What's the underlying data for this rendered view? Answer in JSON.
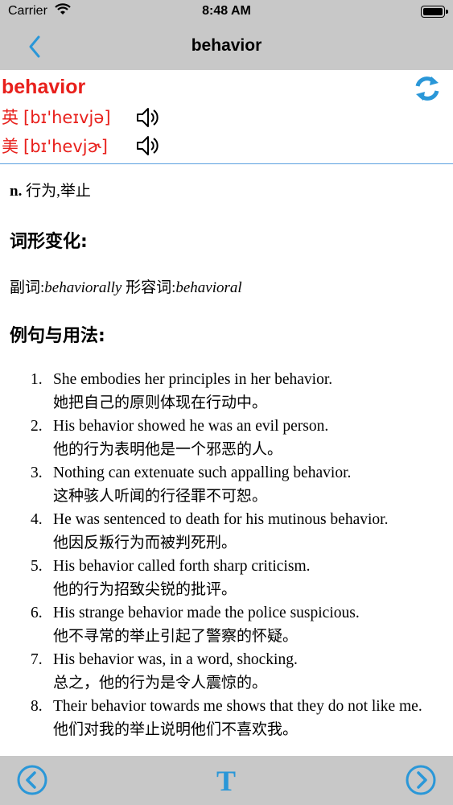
{
  "status": {
    "carrier": "Carrier",
    "time": "8:48 AM"
  },
  "nav": {
    "title": "behavior",
    "back_icon": "chevron-left-icon"
  },
  "word": {
    "headword": "behavior",
    "uk_label": "英",
    "uk_phonetic": "[bɪ'heɪvjə]",
    "us_label": "美",
    "us_phonetic": "[bɪ'hevjɚ]",
    "refresh_icon": "refresh-icon",
    "speaker_icon": "speaker-icon"
  },
  "definition": {
    "pos": "n.",
    "meaning": " 行为,举止"
  },
  "forms": {
    "title": "词形变化:",
    "adverb_label": "副词:",
    "adverb": "behaviorally",
    "adjective_label": " 形容词:",
    "adjective": "behavioral"
  },
  "examples": {
    "title": "例句与用法:",
    "items": [
      {
        "num": "1.",
        "en": "She embodies her principles in her behavior.",
        "zh": "她把自己的原则体现在行动中。"
      },
      {
        "num": "2.",
        "en": "His behavior showed he was an evil person.",
        "zh": "他的行为表明他是一个邪恶的人。"
      },
      {
        "num": "3.",
        "en": "Nothing can extenuate such appalling behavior.",
        "zh": "这种骇人听闻的行径罪不可恕。"
      },
      {
        "num": "4.",
        "en": "He was sentenced to death for his mutinous behavior.",
        "zh": "他因反叛行为而被判死刑。"
      },
      {
        "num": "5.",
        "en": "His behavior called forth sharp criticism.",
        "zh": "他的行为招致尖锐的批评。"
      },
      {
        "num": "6.",
        "en": "His strange behavior made the police suspicious.",
        "zh": "他不寻常的举止引起了警察的怀疑。"
      },
      {
        "num": "7.",
        "en": "His behavior was, in a word, shocking.",
        "zh": "总之，他的行为是令人震惊的。"
      },
      {
        "num": "8.",
        "en": "Their behavior towards me shows that they do not like me.",
        "zh": "他们对我的举止说明他们不喜欢我。"
      }
    ]
  },
  "toolbar": {
    "prev_icon": "circle-arrow-left-icon",
    "font_label": "T",
    "next_icon": "circle-arrow-right-icon"
  },
  "colors": {
    "accent": "#2a97d8",
    "headword": "#e8201c",
    "bars": "#c8c8c8"
  }
}
